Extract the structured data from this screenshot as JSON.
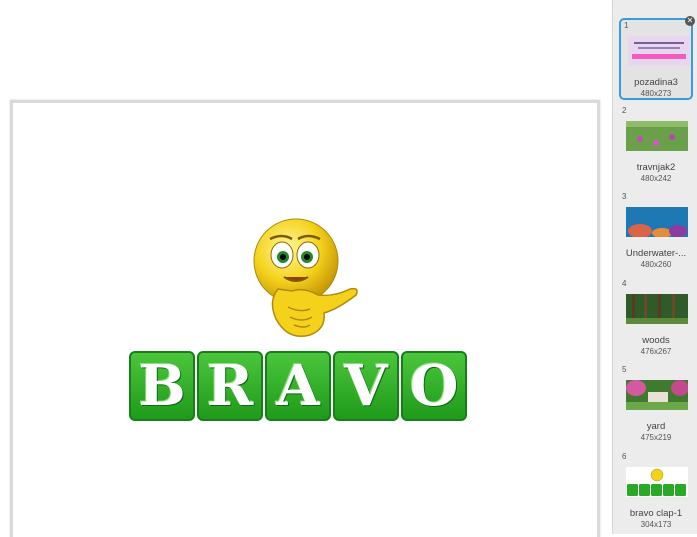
{
  "stage": {
    "bravo_letters": [
      "B",
      "R",
      "A",
      "V",
      "O"
    ]
  },
  "costumes": [
    {
      "num": "1",
      "name": "pozadina3",
      "size": "480x273",
      "selected": true,
      "thumb": "pink-banner"
    },
    {
      "num": "2",
      "name": "travnjak2",
      "size": "480x242",
      "selected": false,
      "thumb": "grass-flowers"
    },
    {
      "num": "3",
      "name": "Underwater-...",
      "size": "480x260",
      "selected": false,
      "thumb": "coral-reef"
    },
    {
      "num": "4",
      "name": "woods",
      "size": "476x267",
      "selected": false,
      "thumb": "forest"
    },
    {
      "num": "5",
      "name": "yard",
      "size": "475x219",
      "selected": false,
      "thumb": "garden-house"
    },
    {
      "num": "6",
      "name": "bravo clap-1",
      "size": "304x173",
      "selected": false,
      "thumb": "bravo-smiley"
    }
  ],
  "colors": {
    "selection_border": "#3c9bd6",
    "bravo_green": "#2aa827"
  }
}
